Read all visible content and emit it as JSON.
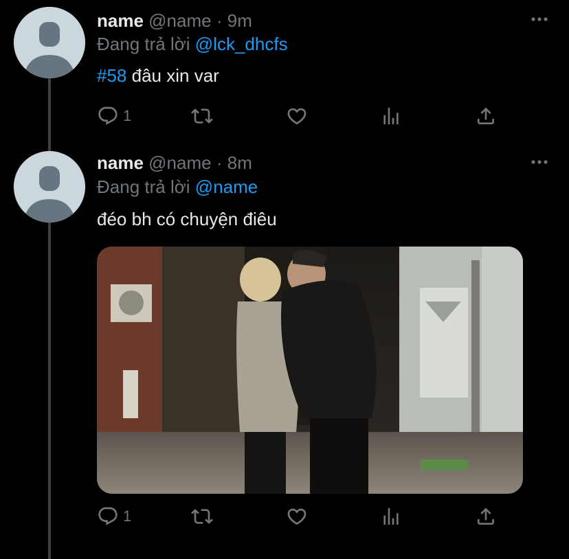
{
  "tweets": [
    {
      "display_name": "name",
      "handle": "@name",
      "separator": "·",
      "time": "9m",
      "reply_prefix": "Đang trả lời",
      "reply_to": "@lck_dhcfs",
      "hashtag": "#58",
      "text": "đâu xin var",
      "reply_count": "1"
    },
    {
      "display_name": "name",
      "handle": "@name",
      "separator": "·",
      "time": "8m",
      "reply_prefix": "Đang trả lời",
      "reply_to": "@name",
      "text": "đéo bh có chuyện điêu",
      "reply_count": "1",
      "media_description": "photo"
    }
  ],
  "icons": {
    "reply": "reply-icon",
    "retweet": "retweet-icon",
    "like": "heart-icon",
    "views": "views-icon",
    "share": "share-icon",
    "more": "more-icon"
  },
  "colors": {
    "background": "#000000",
    "text": "#e7e9ea",
    "muted": "#71767b",
    "link": "#1d9bf0",
    "thread_line": "#3e4144",
    "avatar": "#ccd6dd"
  }
}
